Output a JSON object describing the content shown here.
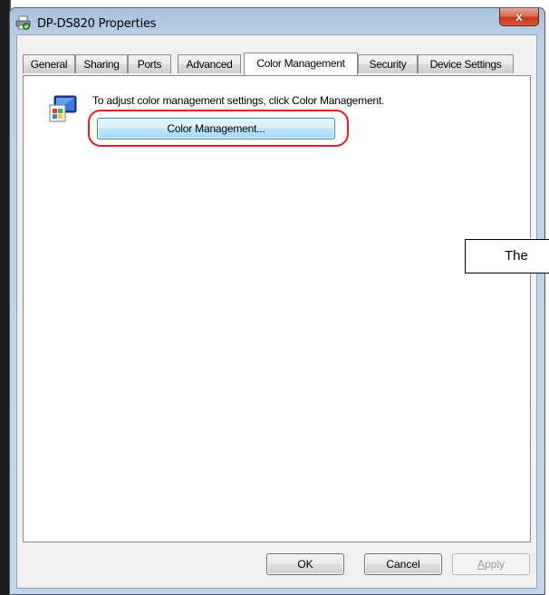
{
  "window": {
    "title": "DP-DS820 Properties",
    "close_label": "x"
  },
  "tabs": [
    {
      "label": "General",
      "active": false
    },
    {
      "label": "Sharing",
      "active": false
    },
    {
      "label": "Ports",
      "active": false
    },
    {
      "label": "Advanced",
      "active": false
    },
    {
      "label": "Color Management",
      "active": true
    },
    {
      "label": "Security",
      "active": false
    },
    {
      "label": "Device Settings",
      "active": false
    }
  ],
  "panel": {
    "description": "To adjust color management settings, click Color Management.",
    "color_management_button": "Color Management..."
  },
  "callout": {
    "text": "The"
  },
  "buttons": {
    "ok": "OK",
    "cancel": "Cancel",
    "apply_first": "A",
    "apply_rest": "pply"
  },
  "colors": {
    "highlight": "#e31e24",
    "close_button": "#c4391c"
  }
}
